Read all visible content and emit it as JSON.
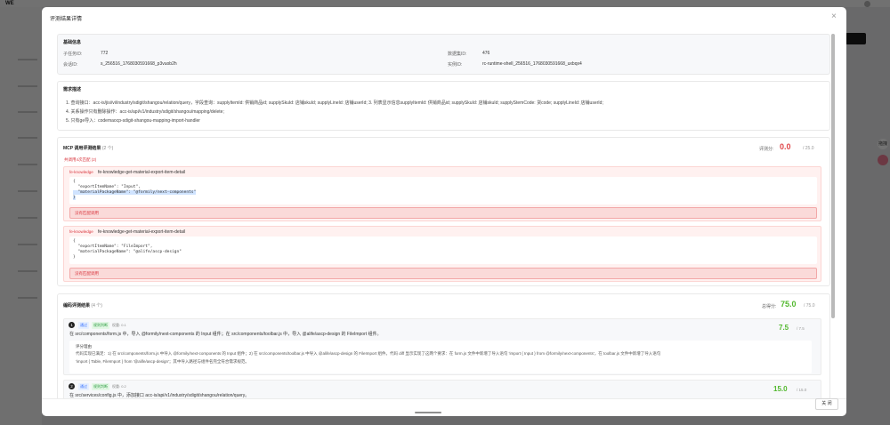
{
  "app": {
    "logo": "WE",
    "float_btn_top": "拖拽",
    "float_btn_bottom": ""
  },
  "modal": {
    "title": "评测结果详情",
    "close_label": "关 闭"
  },
  "basic_info": {
    "title": "基础信息",
    "task_id_label": "子任务ID:",
    "task_id": "772",
    "dataset_id_label": "数据集ID:",
    "dataset_id": "476",
    "session_id_label": "会话ID:",
    "session_id": "s_256516_1768030591668_p3vuob2h",
    "instance_id_label": "实例ID:",
    "instance_id": "rc-runtime-shell_256516_1768030591668_uxbqx4"
  },
  "requirements": {
    "title": "需求描述",
    "lines": [
      "1. 查询接口：acc-is/jisi/vi/industry/sdigit/shangou/relation/query，字段查询：supplyItemId: 供销商品id; supplySkuId: 店铺skuId; supplyLineId: 店铺userId; 3. 列表显示信息supplyItemId: 供销商品id; supplySkuId: 店铺skuId; supplyStemCode: 货code; supplyLineId: 店铺userId;",
      "4. 关系操作只有删除操作：acc-is/api/v1/industry/sdigit/shangou/mapping/delete;",
      "5. 只有ge导入：codemaocp-sdigit-shangou-mapping-import-handler"
    ]
  },
  "mcp": {
    "title": "MCP 调用评测结果",
    "count": "(2 个)",
    "score_label": "评测分:",
    "score": "0.0",
    "score_total": "/ 25.0",
    "error_note": "共调用4次匹配 (2)",
    "items": [
      {
        "tag": "fe-knowledge",
        "tool": "fe-knowledge-get-material-export-item-detail",
        "code": [
          "{",
          "  \"exportItemName\": \"Input\",",
          "  \"materialPackageName\": \"@formily/next-components\"",
          "}"
        ],
        "fail": "没有匹配调用"
      },
      {
        "tag": "fe-knowledge",
        "tool": "fe-knowledge-get-material-export-item-detail",
        "code": [
          "{",
          "  \"exportItemName\": \"FileImport\",",
          "  \"materialPackageName\": \"@alife/ascp-design\"",
          "}"
        ],
        "fail": "没有匹配调用"
      }
    ]
  },
  "eval": {
    "title": "编码评测结果",
    "count": "(4 个)",
    "score_label": "总得分:",
    "score": "75.0",
    "score_total": "/ 75.0",
    "items": [
      {
        "num": "1",
        "badge1": "通过",
        "badge2": "规则判断",
        "weight": "权重: 0.1",
        "desc": "在 src/components/form.js 中，导入 @formily/next-components 的 Input 组件；在 src/components/toolbar.js 中，导入 @alife/ascp-design 的 FileImport 组件。",
        "score": "7.5",
        "score_total": "/ 7.5",
        "reason_title": "评分理由",
        "reason": "代码实现已满足：1) 在 src/components/form.js 中导入 @formily/next-components 的 Input 组件；2) 在 src/components/toolbar.js 中导入 @alife/ascp-design 的 FileImport 组件。代码 diff 显示实现了这两个要求：在 form.js 文件中新增了导入语句 'import { Input } from @formily/next-components'，在 toolbar.js 文件中新增了导入语句",
        "reason2": "'import { Table, FileImport } from '@alife/ascp-design'；其中导入路径与组件名完全符合需求规范。"
      },
      {
        "num": "2",
        "badge1": "通过",
        "badge2": "规则判断",
        "weight": "权重: 0.2",
        "desc": "在 src/services/config.js 中，添加接口 acc-is/api/v1/industry/sdigit/shangou/relation/query。",
        "score": "15.0",
        "score_total": "/ 15.0"
      }
    ]
  },
  "colors": {
    "fail_red": "#e0474a",
    "pass_green": "#52b82e",
    "tag_blue": "#2f6bff"
  }
}
